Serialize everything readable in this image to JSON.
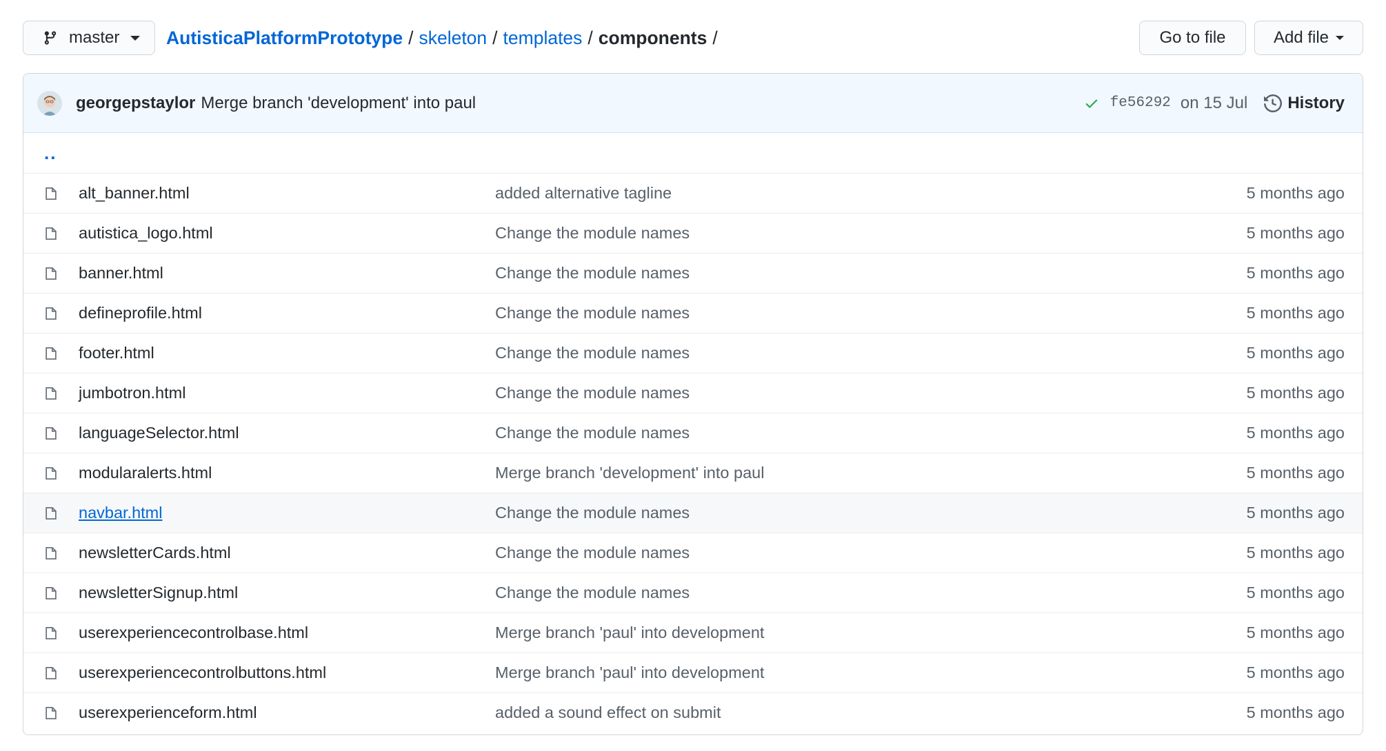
{
  "branch": {
    "label": "master"
  },
  "breadcrumb": {
    "repo": "AutisticaPlatformPrototype",
    "sep": "/",
    "parts": [
      "skeleton",
      "templates"
    ],
    "current": "components",
    "trailing": "/"
  },
  "actions": {
    "go_to_file": "Go to file",
    "add_file": "Add file"
  },
  "commit": {
    "author": "georgepstaylor",
    "message": "Merge branch 'development' into paul",
    "sha": "fe56292",
    "date": "on 15 Jul",
    "history": "History",
    "status_color": "#28a745"
  },
  "parent_dir": "..",
  "files": [
    {
      "name": "alt_banner.html",
      "message": "added alternative tagline",
      "age": "5 months ago"
    },
    {
      "name": "autistica_logo.html",
      "message": "Change the module names",
      "age": "5 months ago"
    },
    {
      "name": "banner.html",
      "message": "Change the module names",
      "age": "5 months ago"
    },
    {
      "name": "defineprofile.html",
      "message": "Change the module names",
      "age": "5 months ago"
    },
    {
      "name": "footer.html",
      "message": "Change the module names",
      "age": "5 months ago"
    },
    {
      "name": "jumbotron.html",
      "message": "Change the module names",
      "age": "5 months ago"
    },
    {
      "name": "languageSelector.html",
      "message": "Change the module names",
      "age": "5 months ago"
    },
    {
      "name": "modularalerts.html",
      "message": "Merge branch 'development' into paul",
      "age": "5 months ago"
    },
    {
      "name": "navbar.html",
      "message": "Change the module names",
      "age": "5 months ago"
    },
    {
      "name": "newsletterCards.html",
      "message": "Change the module names",
      "age": "5 months ago"
    },
    {
      "name": "newsletterSignup.html",
      "message": "Change the module names",
      "age": "5 months ago"
    },
    {
      "name": "userexperiencecontrolbase.html",
      "message": "Merge branch 'paul' into development",
      "age": "5 months ago"
    },
    {
      "name": "userexperiencecontrolbuttons.html",
      "message": "Merge branch 'paul' into development",
      "age": "5 months ago"
    },
    {
      "name": "userexperienceform.html",
      "message": "added a sound effect on submit",
      "age": "5 months ago"
    }
  ],
  "hovered_file": "navbar.html",
  "colors": {
    "link": "#0366d6",
    "commit_bar_bg": "#f1f8ff",
    "row_hover": "#f6f8fa"
  }
}
